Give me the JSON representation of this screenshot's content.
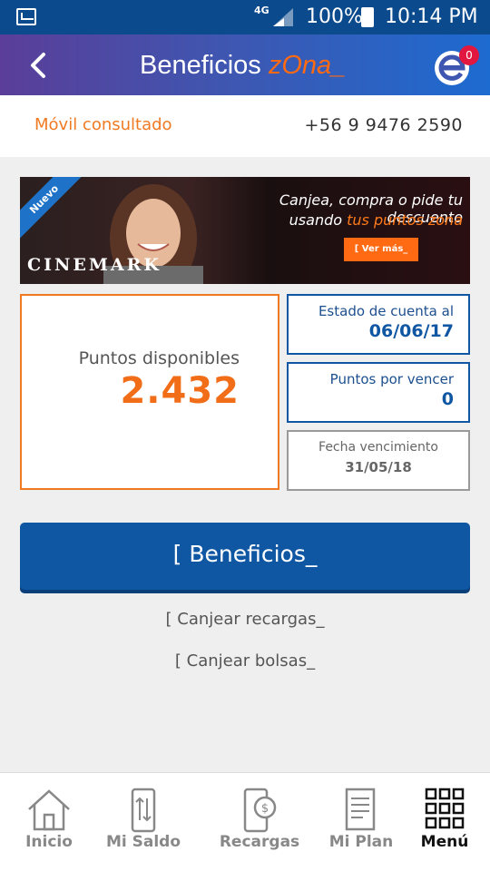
{
  "status_bar": {
    "network": "4G",
    "battery": "100%",
    "time": "10:14 PM"
  },
  "header": {
    "title": "Beneficios",
    "title_accent": "zOna_",
    "notification_count": "0"
  },
  "movil": {
    "label": "Móvil consultado",
    "number": "+56 9 9476 2590"
  },
  "banner": {
    "ribbon": "Nuevo",
    "line1": "Canjea, compra o pide tu descuento",
    "line2_prefix": "usando ",
    "line2_highlight": "tus puntos zona",
    "button": "[ Ver más_",
    "brand": "CINEMARK"
  },
  "points": {
    "label": "Puntos disponibles",
    "value": "2.432"
  },
  "account_status": {
    "label": "Estado de cuenta al",
    "value": "06/06/17"
  },
  "expiring": {
    "label": "Puntos por vencer",
    "value": "0"
  },
  "expiry_date": {
    "label": "Fecha vencimiento",
    "value": "31/05/18"
  },
  "actions": {
    "benefits": "[ Beneficios_",
    "recargas": "[ Canjear recargas_",
    "bolsas": "[ Canjear bolsas_"
  },
  "nav": [
    {
      "label": "Inicio",
      "icon": "home-icon"
    },
    {
      "label": "Mi Saldo",
      "icon": "phone-transfer-icon"
    },
    {
      "label": "Recargas",
      "icon": "phone-money-icon"
    },
    {
      "label": "Mi Plan",
      "icon": "document-icon"
    },
    {
      "label": "Menú",
      "icon": "grid-icon"
    }
  ],
  "colors": {
    "accent_orange": "#f26d18",
    "primary_blue": "#0f56a3",
    "status_bar": "#0b4a8c"
  }
}
